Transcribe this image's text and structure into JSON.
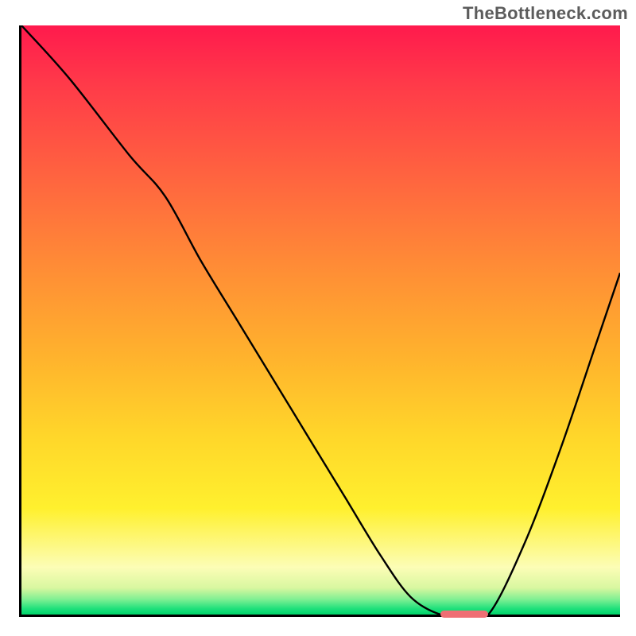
{
  "watermark": "TheBottleneck.com",
  "colors": {
    "axis": "#000000",
    "curve": "#000000",
    "marker": "#ef6e74",
    "gradient_top": "#ff1a4d",
    "gradient_bottom": "#00d56a"
  },
  "chart_data": {
    "type": "line",
    "title": "",
    "xlabel": "",
    "ylabel": "",
    "xlim": [
      0,
      100
    ],
    "ylim": [
      0,
      100
    ],
    "grid": false,
    "legend": false,
    "series": [
      {
        "name": "curve",
        "x": [
          0,
          8,
          18,
          24,
          30,
          36,
          42,
          48,
          54,
          60,
          65,
          70,
          74,
          78,
          84,
          90,
          96,
          100
        ],
        "values": [
          100,
          91,
          78,
          71,
          60,
          50,
          40,
          30,
          20,
          10,
          3,
          0,
          0,
          0,
          12,
          28,
          46,
          58
        ]
      }
    ],
    "marker": {
      "x_start": 70,
      "x_end": 78,
      "y": 0
    },
    "background_gradient": {
      "direction": "vertical",
      "stops": [
        {
          "pct": 0,
          "color": "#ff1a4d"
        },
        {
          "pct": 28,
          "color": "#ff6a3e"
        },
        {
          "pct": 56,
          "color": "#ffb22d"
        },
        {
          "pct": 82,
          "color": "#fff02e"
        },
        {
          "pct": 92,
          "color": "#fcfdb6"
        },
        {
          "pct": 100,
          "color": "#00d56a"
        }
      ]
    }
  }
}
